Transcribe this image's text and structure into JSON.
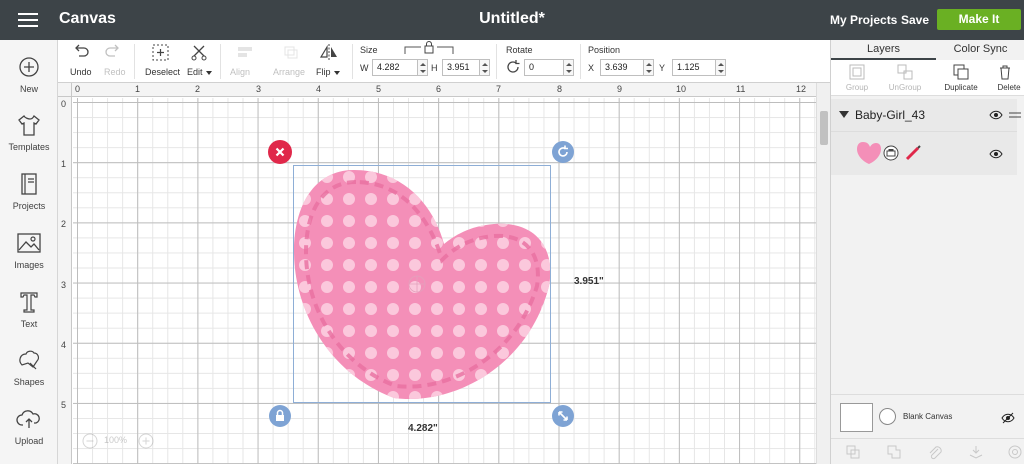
{
  "header": {
    "app_title": "Canvas",
    "doc_title": "Untitled*",
    "my_projects": "My Projects",
    "save": "Save",
    "make_it": "Make It"
  },
  "sidebar": {
    "items": [
      {
        "label": "New",
        "icon": "plus-circle-icon"
      },
      {
        "label": "Templates",
        "icon": "tshirt-icon"
      },
      {
        "label": "Projects",
        "icon": "book-icon"
      },
      {
        "label": "Images",
        "icon": "image-icon"
      },
      {
        "label": "Text",
        "icon": "text-t-icon"
      },
      {
        "label": "Shapes",
        "icon": "shapes-icon"
      },
      {
        "label": "Upload",
        "icon": "cloud-upload-icon"
      }
    ]
  },
  "toolbar": {
    "undo": "Undo",
    "redo": "Redo",
    "deselect": "Deselect",
    "edit": "Edit",
    "align": "Align",
    "arrange": "Arrange",
    "flip": "Flip",
    "size_label": "Size",
    "w_label": "W",
    "w_value": "4.282",
    "h_label": "H",
    "h_value": "3.951",
    "rotate_label": "Rotate",
    "rotate_value": "0",
    "position_label": "Position",
    "x_label": "X",
    "x_value": "3.639",
    "y_label": "Y",
    "y_value": "1.125"
  },
  "canvas": {
    "ruler_top": [
      "0",
      "1",
      "2",
      "3",
      "4",
      "5",
      "6",
      "7",
      "8",
      "9",
      "10",
      "11",
      "12"
    ],
    "ruler_left": [
      "0",
      "1",
      "2",
      "3",
      "4",
      "5"
    ],
    "width_label": "4.282\"",
    "height_label": "3.951\"",
    "zoom": "100%",
    "heart_color": "#f48fb8",
    "dot_color": "#fbc8dc",
    "stitch_color": "#e86fa0"
  },
  "panel": {
    "tab_layers": "Layers",
    "tab_color_sync": "Color Sync",
    "tools": {
      "group": "Group",
      "ungroup": "UnGroup",
      "duplicate": "Duplicate",
      "delete": "Delete"
    },
    "group_name": "Baby-Girl_43",
    "blank_canvas": "Blank Canvas"
  },
  "colors": {
    "header_bg": "#3d4448",
    "make_it": "#6ab023",
    "close_handle": "#e0284a",
    "handle_blue": "#7ea3d4"
  }
}
